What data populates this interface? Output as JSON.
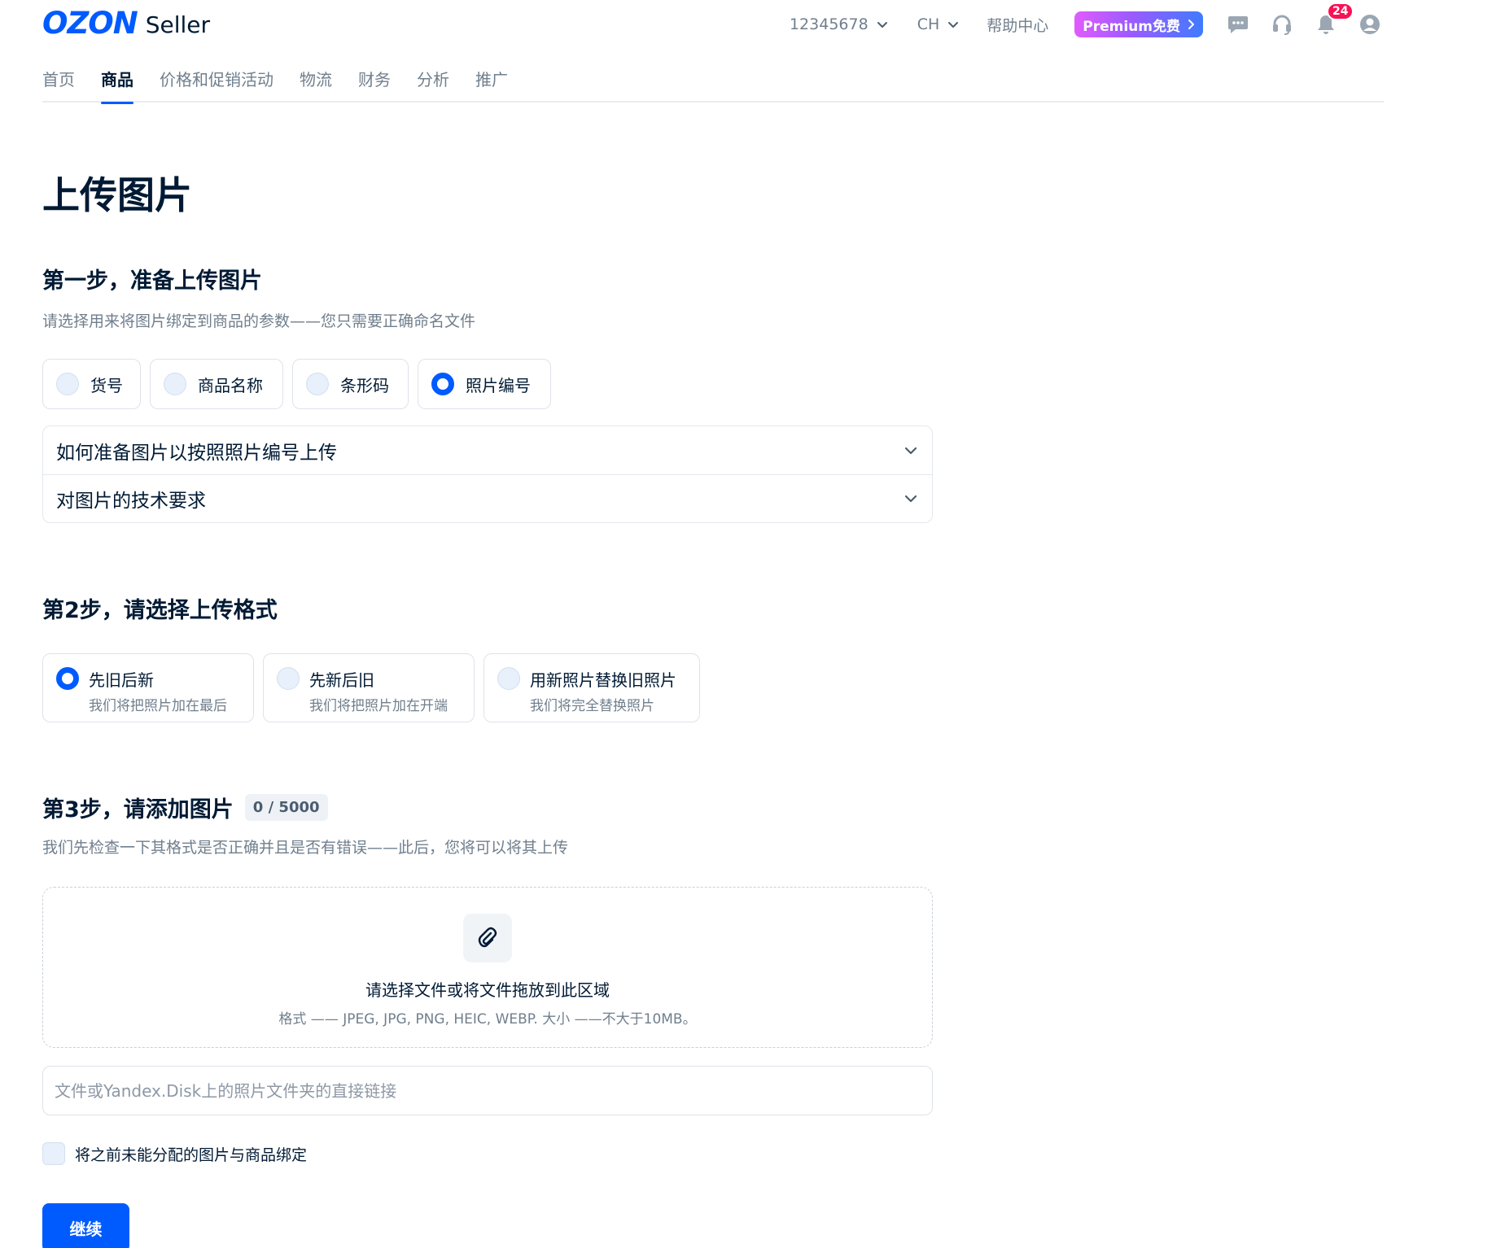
{
  "header": {
    "logo_text": "OZON",
    "logo_sub": "Seller",
    "account_id": "12345678",
    "language": "CH",
    "help": "帮助中心",
    "premium_label": "Premium免费",
    "notifications_count": "24",
    "icons": [
      "chat-icon",
      "headset-icon",
      "bell-icon",
      "user-icon"
    ]
  },
  "nav": {
    "items": [
      {
        "label": "首页",
        "active": false
      },
      {
        "label": "商品",
        "active": true
      },
      {
        "label": "价格和促销活动",
        "active": false
      },
      {
        "label": "物流",
        "active": false
      },
      {
        "label": "财务",
        "active": false
      },
      {
        "label": "分析",
        "active": false
      },
      {
        "label": "推广",
        "active": false
      }
    ]
  },
  "page": {
    "title": "上传图片"
  },
  "step1": {
    "title": "第一步，准备上传图片",
    "subtitle": "请选择用来将图片绑定到商品的参数——您只需要正确命名文件",
    "options": [
      {
        "label": "货号",
        "selected": false
      },
      {
        "label": "商品名称",
        "selected": false
      },
      {
        "label": "条形码",
        "selected": false
      },
      {
        "label": "照片编号",
        "selected": true
      }
    ],
    "accordion": [
      {
        "label": "如何准备图片以按照照片编号上传"
      },
      {
        "label": "对图片的技术要求"
      }
    ]
  },
  "step2": {
    "title": "第2步，请选择上传格式",
    "options": [
      {
        "title": "先旧后新",
        "desc": "我们将把照片加在最后",
        "selected": true
      },
      {
        "title": "先新后旧",
        "desc": "我们将把照片加在开端",
        "selected": false
      },
      {
        "title": "用新照片替换旧照片",
        "desc": "我们将完全替换照片",
        "selected": false
      }
    ]
  },
  "step3": {
    "title": "第3步，请添加图片",
    "counter": "0 / 5000",
    "subtitle": "我们先检查一下其格式是否正确并且是否有错误——此后，您将可以将其上传",
    "dropzone_title": "请选择文件或将文件拖放到此区域",
    "dropzone_hint": "格式 —— JPEG, JPG, PNG, HEIC, WEBP. 大小 ——不大于10MB。",
    "link_placeholder": "文件或Yandex.Disk上的照片文件夹的直接链接",
    "link_value": "",
    "checkbox_label": "将之前未能分配的图片与商品绑定",
    "checkbox_checked": false
  },
  "actions": {
    "continue_label": "继续"
  },
  "colors": {
    "accent": "#005bff",
    "badge": "#f91155",
    "muted_text": "#707f8d"
  }
}
